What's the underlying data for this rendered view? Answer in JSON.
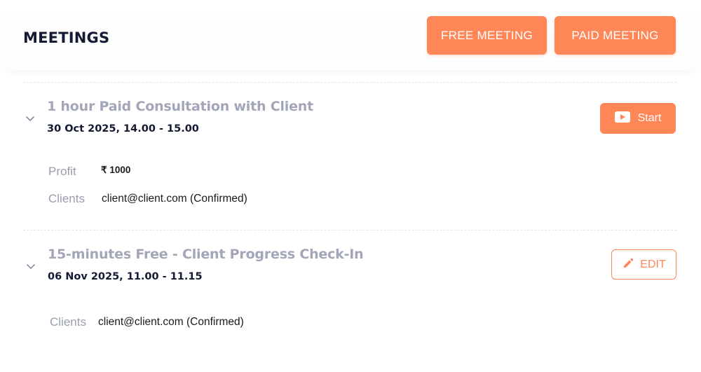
{
  "header": {
    "title": "MEETINGS",
    "free_meeting_label": "FREE MEETING",
    "paid_meeting_label": "PAID MEETING"
  },
  "meetings": [
    {
      "title": "1 hour Paid Consultation with Client",
      "datetime": "30 Oct 2025, 14.00 - 15.00",
      "action_label": "Start",
      "action_icon": "video-play-icon",
      "profit_label": "Profit",
      "profit_value": "₹ 1000",
      "clients_label": "Clients",
      "clients_value": "client@client.com (Confirmed)"
    },
    {
      "title": "15-minutes Free - Client Progress Check-In",
      "datetime": "06 Nov 2025, 11.00 - 11.15",
      "action_label": "EDIT",
      "action_icon": "pencil-icon",
      "clients_label": "Clients",
      "clients_value": "client@client.com (Confirmed)"
    }
  ],
  "colors": {
    "accent": "#ff8657",
    "title_muted": "#a3a6b8",
    "text_dark": "#141a33",
    "label_muted": "#9a9db0"
  }
}
